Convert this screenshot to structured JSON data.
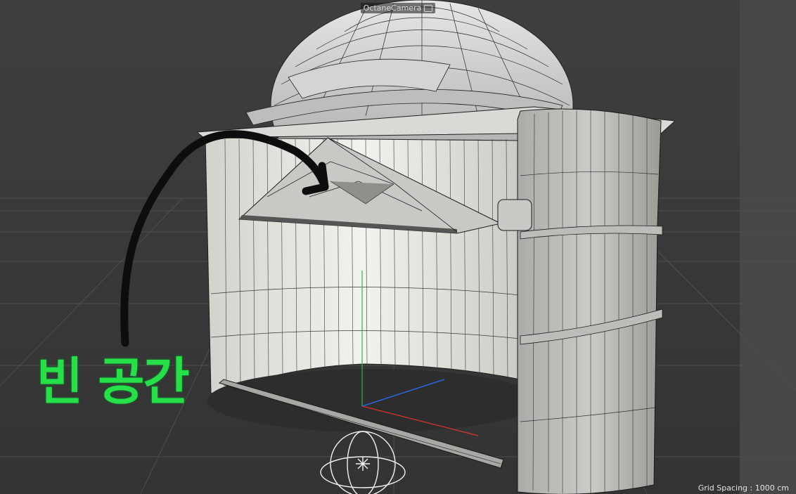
{
  "viewport": {
    "camera_name": "OctaneCamera",
    "grid_spacing_text": "Grid Spacing : 1000 cm",
    "annotation_text": "빈 공간"
  },
  "colors": {
    "background": "#3a3a3a",
    "annotation": "#26e04a",
    "axis_x": "#e03030",
    "axis_y": "#2cb34a",
    "axis_z": "#2a6cff"
  },
  "icons": [
    "camera-icon",
    "camera-gizmo-icon"
  ]
}
